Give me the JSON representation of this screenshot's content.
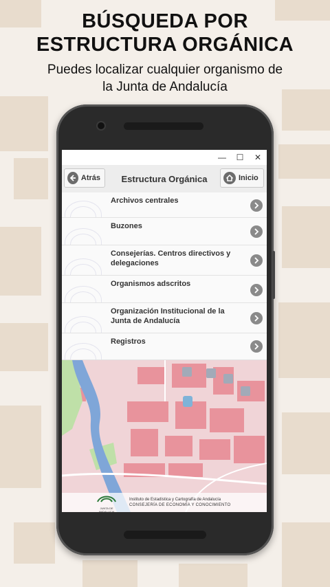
{
  "promo": {
    "title_line1": "BÚSQUEDA POR",
    "title_line2": "ESTRUCTURA ORGÁNICA",
    "subtitle_line1": "Puedes localizar cualquier organismo de",
    "subtitle_line2": "la Junta de Andalucía"
  },
  "window": {
    "minimize": "—",
    "maximize": "☐",
    "close": "✕"
  },
  "toolbar": {
    "back_label": "Atrás",
    "title": "Estructura Orgánica",
    "home_label": "Inicio"
  },
  "list": {
    "items": [
      {
        "label": "Archivos centrales"
      },
      {
        "label": "Buzones"
      },
      {
        "label": "Consejerías. Centros directivos y delegaciones"
      },
      {
        "label": "Organismos adscritos"
      },
      {
        "label": "Organización Institucional de la Junta de Andalucía"
      },
      {
        "label": "Registros"
      }
    ]
  },
  "footer": {
    "org_line1": "Instituto de Estadística y Cartografía de Andalucía",
    "org_line2": "CONSEJERÍA DE ECONOMÍA Y CONOCIMIENTO",
    "logo_label": "JUNTA DE ANDALUCIA"
  },
  "colors": {
    "map_background": "#f0d4d7",
    "map_blocks": "#e8939c",
    "river": "#7fa6d8",
    "park": "#bfe0a8"
  }
}
